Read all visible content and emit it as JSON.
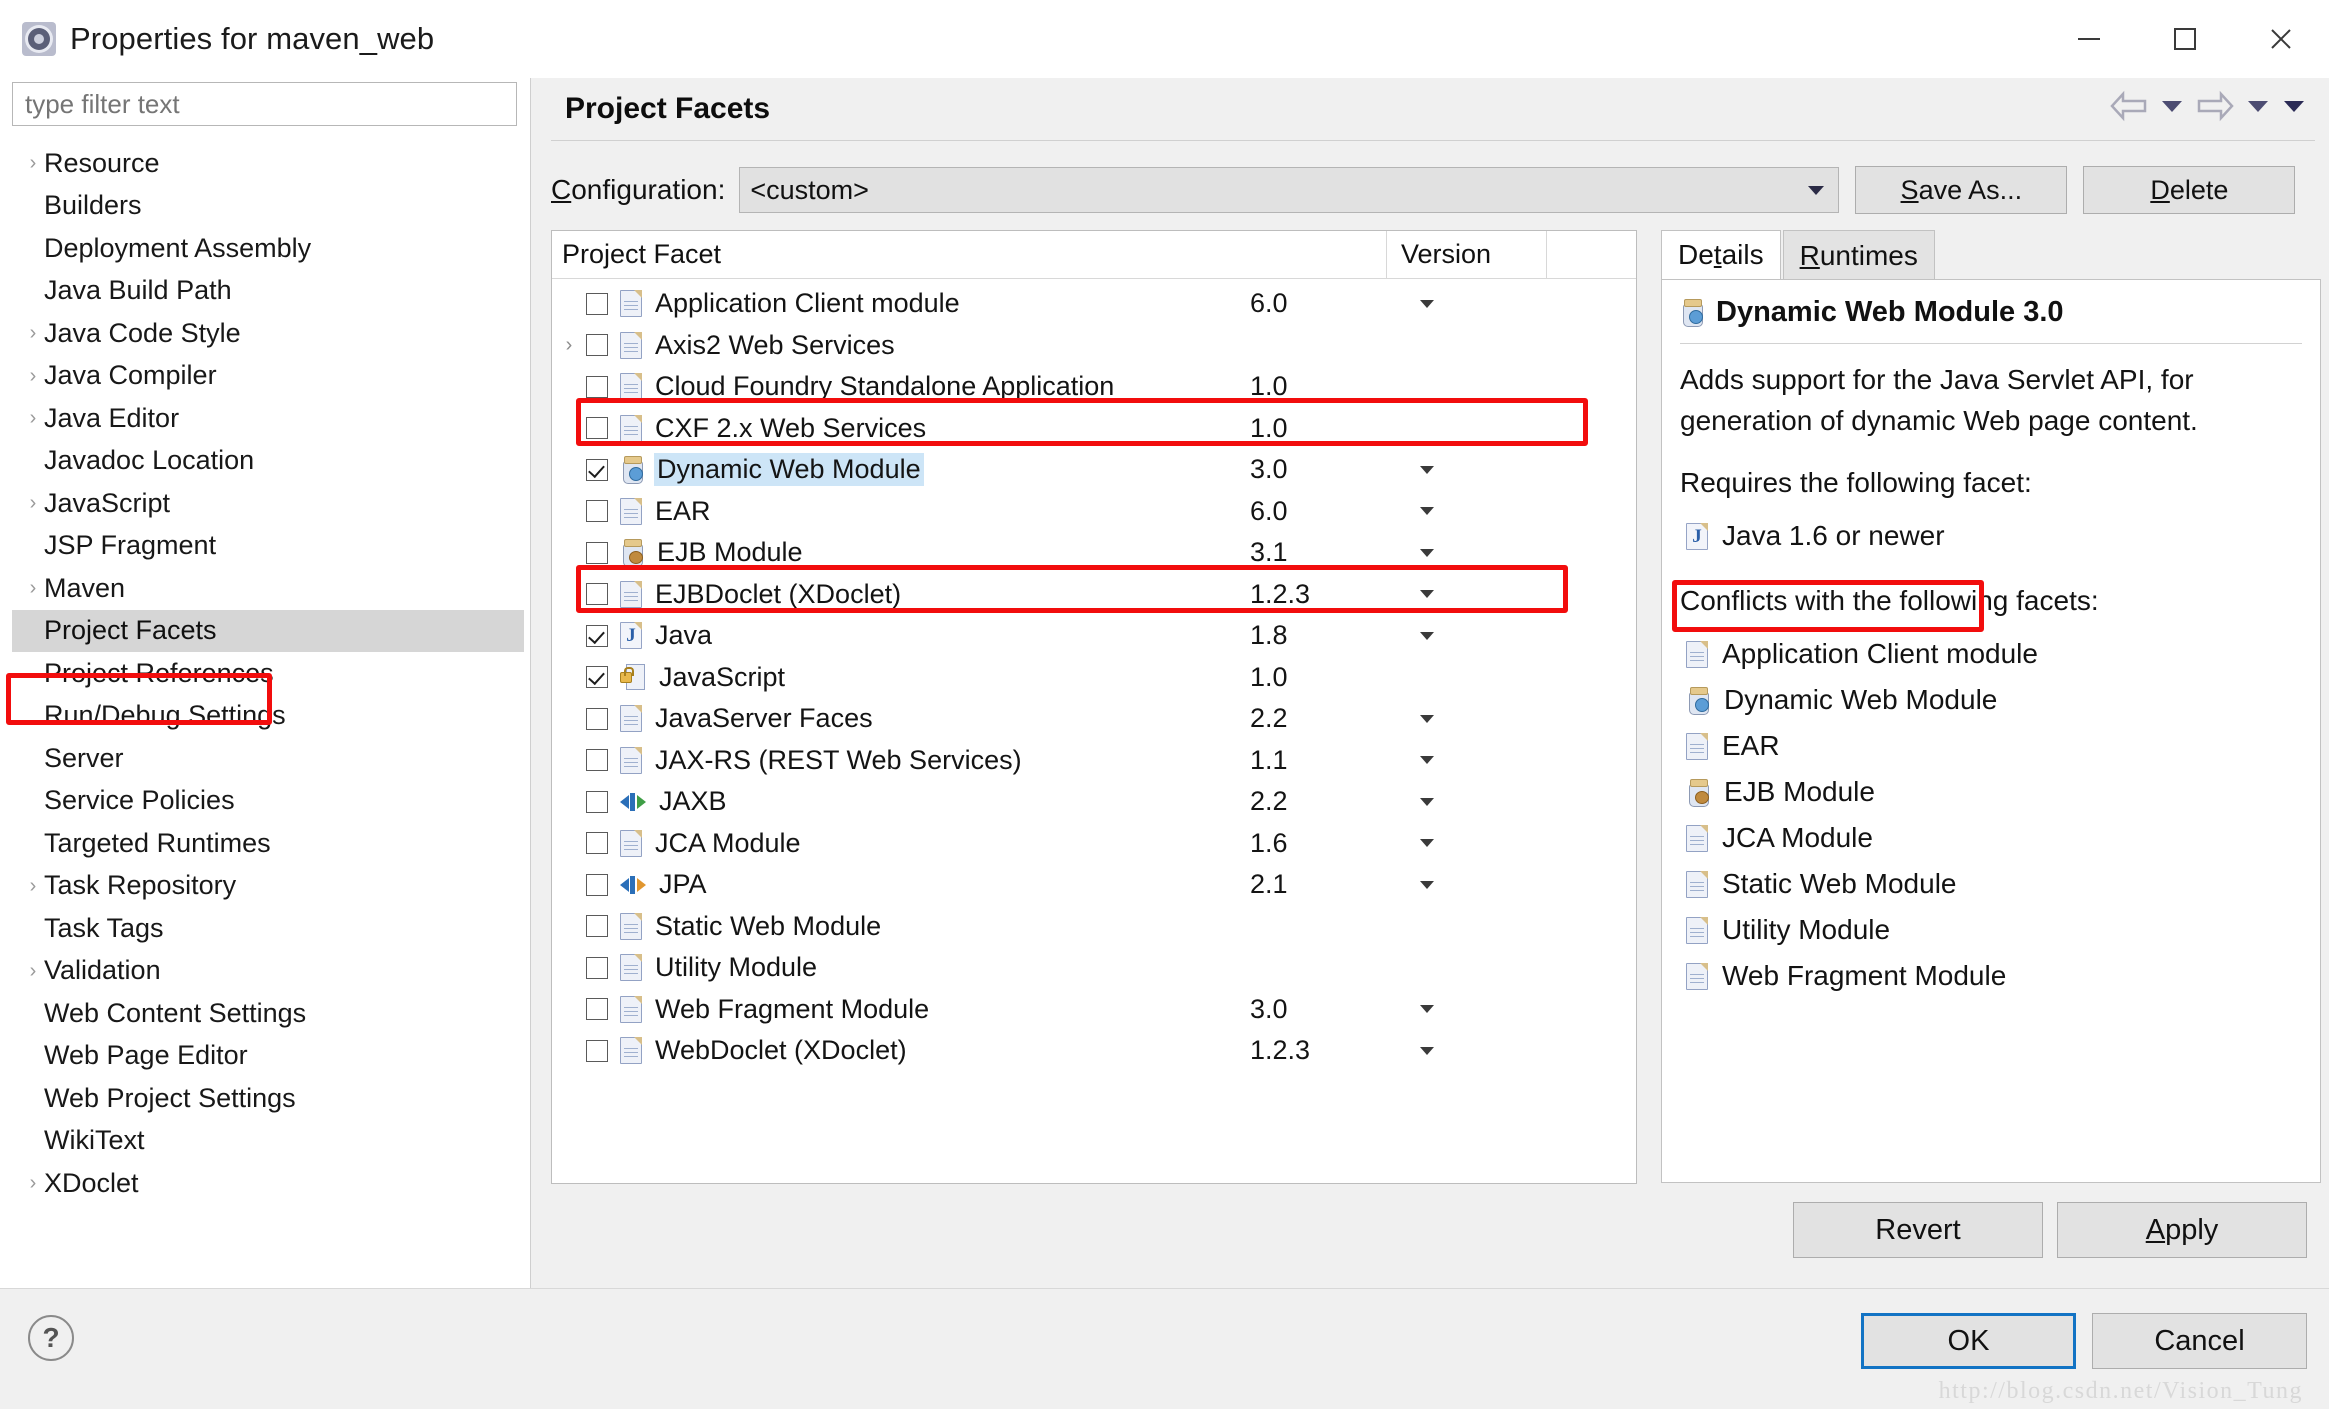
{
  "window": {
    "title": "Properties for maven_web",
    "icon": "properties-gear-icon",
    "minimize_label": "—",
    "maximize_label": "□",
    "close_label": "✕"
  },
  "filter": {
    "placeholder": "type filter text",
    "value": ""
  },
  "sidebar": {
    "items": [
      {
        "label": "Resource",
        "expandable": true,
        "selected": false
      },
      {
        "label": "Builders",
        "expandable": false,
        "selected": false
      },
      {
        "label": "Deployment Assembly",
        "expandable": false,
        "selected": false
      },
      {
        "label": "Java Build Path",
        "expandable": false,
        "selected": false
      },
      {
        "label": "Java Code Style",
        "expandable": true,
        "selected": false
      },
      {
        "label": "Java Compiler",
        "expandable": true,
        "selected": false
      },
      {
        "label": "Java Editor",
        "expandable": true,
        "selected": false
      },
      {
        "label": "Javadoc Location",
        "expandable": false,
        "selected": false
      },
      {
        "label": "JavaScript",
        "expandable": true,
        "selected": false
      },
      {
        "label": "JSP Fragment",
        "expandable": false,
        "selected": false
      },
      {
        "label": "Maven",
        "expandable": true,
        "selected": false
      },
      {
        "label": "Project Facets",
        "expandable": false,
        "selected": true
      },
      {
        "label": "Project References",
        "expandable": false,
        "selected": false
      },
      {
        "label": "Run/Debug Settings",
        "expandable": false,
        "selected": false
      },
      {
        "label": "Server",
        "expandable": false,
        "selected": false
      },
      {
        "label": "Service Policies",
        "expandable": false,
        "selected": false
      },
      {
        "label": "Targeted Runtimes",
        "expandable": false,
        "selected": false
      },
      {
        "label": "Task Repository",
        "expandable": true,
        "selected": false
      },
      {
        "label": "Task Tags",
        "expandable": false,
        "selected": false
      },
      {
        "label": "Validation",
        "expandable": true,
        "selected": false
      },
      {
        "label": "Web Content Settings",
        "expandable": false,
        "selected": false
      },
      {
        "label": "Web Page Editor",
        "expandable": false,
        "selected": false
      },
      {
        "label": "Web Project Settings",
        "expandable": false,
        "selected": false
      },
      {
        "label": "WikiText",
        "expandable": false,
        "selected": false
      },
      {
        "label": "XDoclet",
        "expandable": true,
        "selected": false
      }
    ]
  },
  "page": {
    "title": "Project Facets",
    "nav": {
      "back_icon": "back-arrow-icon",
      "back_menu_icon": "chevron-down-icon",
      "forward_icon": "forward-arrow-icon",
      "forward_menu_icon": "chevron-down-icon",
      "more_icon": "chevron-down-icon"
    }
  },
  "configuration": {
    "label_prefix": "C",
    "label_rest": "onfiguration:",
    "value": "<custom>",
    "save_as_prefix": "S",
    "save_as_rest": "ave As...",
    "delete_prefix": "D",
    "delete_rest": "elete"
  },
  "facet_table": {
    "columns": {
      "name": "Project Facet",
      "version": "Version"
    },
    "rows": [
      {
        "name": "Application Client module",
        "version": "6.0",
        "checked": false,
        "expandable": false,
        "icon": "document-icon",
        "has_version_menu": true,
        "selected": false,
        "highlighted": false
      },
      {
        "name": "Axis2 Web Services",
        "version": "",
        "checked": false,
        "expandable": true,
        "icon": "document-icon",
        "has_version_menu": false,
        "selected": false,
        "highlighted": false
      },
      {
        "name": "Cloud Foundry Standalone Application",
        "version": "1.0",
        "checked": false,
        "expandable": false,
        "icon": "document-icon",
        "has_version_menu": false,
        "selected": false,
        "highlighted": false
      },
      {
        "name": "CXF 2.x Web Services",
        "version": "1.0",
        "checked": false,
        "expandable": false,
        "icon": "document-icon",
        "has_version_menu": false,
        "selected": false,
        "highlighted": false
      },
      {
        "name": "Dynamic Web Module",
        "version": "3.0",
        "checked": true,
        "expandable": false,
        "icon": "web-module-jar-icon",
        "has_version_menu": true,
        "selected": true,
        "highlighted": true
      },
      {
        "name": "EAR",
        "version": "6.0",
        "checked": false,
        "expandable": false,
        "icon": "document-icon",
        "has_version_menu": true,
        "selected": false,
        "highlighted": false
      },
      {
        "name": "EJB Module",
        "version": "3.1",
        "checked": false,
        "expandable": false,
        "icon": "ejb-jar-icon",
        "has_version_menu": true,
        "selected": false,
        "highlighted": false
      },
      {
        "name": "EJBDoclet (XDoclet)",
        "version": "1.2.3",
        "checked": false,
        "expandable": false,
        "icon": "document-icon",
        "has_version_menu": true,
        "selected": false,
        "highlighted": false
      },
      {
        "name": "Java",
        "version": "1.8",
        "checked": true,
        "expandable": false,
        "icon": "java-file-icon",
        "has_version_menu": true,
        "selected": false,
        "highlighted": true
      },
      {
        "name": "JavaScript",
        "version": "1.0",
        "checked": true,
        "expandable": false,
        "icon": "javascript-locked-icon",
        "has_version_menu": false,
        "selected": false,
        "highlighted": false
      },
      {
        "name": "JavaServer Faces",
        "version": "2.2",
        "checked": false,
        "expandable": false,
        "icon": "document-icon",
        "has_version_menu": true,
        "selected": false,
        "highlighted": false
      },
      {
        "name": "JAX-RS (REST Web Services)",
        "version": "1.1",
        "checked": false,
        "expandable": false,
        "icon": "document-icon",
        "has_version_menu": true,
        "selected": false,
        "highlighted": false
      },
      {
        "name": "JAXB",
        "version": "2.2",
        "checked": false,
        "expandable": false,
        "icon": "jaxb-arrows-icon",
        "has_version_menu": true,
        "selected": false,
        "highlighted": false
      },
      {
        "name": "JCA Module",
        "version": "1.6",
        "checked": false,
        "expandable": false,
        "icon": "document-icon",
        "has_version_menu": true,
        "selected": false,
        "highlighted": false
      },
      {
        "name": "JPA",
        "version": "2.1",
        "checked": false,
        "expandable": false,
        "icon": "jpa-arrows-icon",
        "has_version_menu": true,
        "selected": false,
        "highlighted": false
      },
      {
        "name": "Static Web Module",
        "version": "",
        "checked": false,
        "expandable": false,
        "icon": "document-icon",
        "has_version_menu": false,
        "selected": false,
        "highlighted": false
      },
      {
        "name": "Utility Module",
        "version": "",
        "checked": false,
        "expandable": false,
        "icon": "document-icon",
        "has_version_menu": false,
        "selected": false,
        "highlighted": false
      },
      {
        "name": "Web Fragment Module",
        "version": "3.0",
        "checked": false,
        "expandable": false,
        "icon": "document-icon",
        "has_version_menu": true,
        "selected": false,
        "highlighted": false
      },
      {
        "name": "WebDoclet (XDoclet)",
        "version": "1.2.3",
        "checked": false,
        "expandable": false,
        "icon": "document-icon",
        "has_version_menu": true,
        "selected": false,
        "highlighted": false
      }
    ]
  },
  "details": {
    "tabs": [
      {
        "prefix": "De",
        "mnemonic": "t",
        "suffix": "ails",
        "active": true
      },
      {
        "prefix": "",
        "mnemonic": "R",
        "suffix": "untimes",
        "active": false
      }
    ],
    "heading": "Dynamic Web Module 3.0",
    "heading_icon": "web-module-jar-icon",
    "description": "Adds support for the Java Servlet API, for generation of dynamic Web page content.",
    "requires_label": "Requires the following facet:",
    "requires": [
      {
        "label": "Java 1.6 or newer",
        "icon": "java-file-icon",
        "highlighted": true
      }
    ],
    "conflicts_label": "Conflicts with the following facets:",
    "conflicts": [
      {
        "label": "Application Client module",
        "icon": "document-icon"
      },
      {
        "label": "Dynamic Web Module",
        "icon": "web-module-jar-icon"
      },
      {
        "label": "EAR",
        "icon": "document-icon"
      },
      {
        "label": "EJB Module",
        "icon": "ejb-jar-icon"
      },
      {
        "label": "JCA Module",
        "icon": "document-icon"
      },
      {
        "label": "Static Web Module",
        "icon": "document-icon"
      },
      {
        "label": "Utility Module",
        "icon": "document-icon"
      },
      {
        "label": "Web Fragment Module",
        "icon": "document-icon"
      }
    ]
  },
  "actions": {
    "revert": "Revert",
    "apply_prefix": "A",
    "apply_rest": "pply",
    "ok": "OK",
    "cancel": "Cancel",
    "help_icon": "help-question-icon"
  },
  "watermark": "http://blog.csdn.net/Vision_Tung",
  "colors": {
    "selection_blue": "#cde5f7",
    "annotation_red": "#f20d0d",
    "default_button_border": "#1273c4",
    "tree_selection_gray": "#d6d6d6"
  }
}
